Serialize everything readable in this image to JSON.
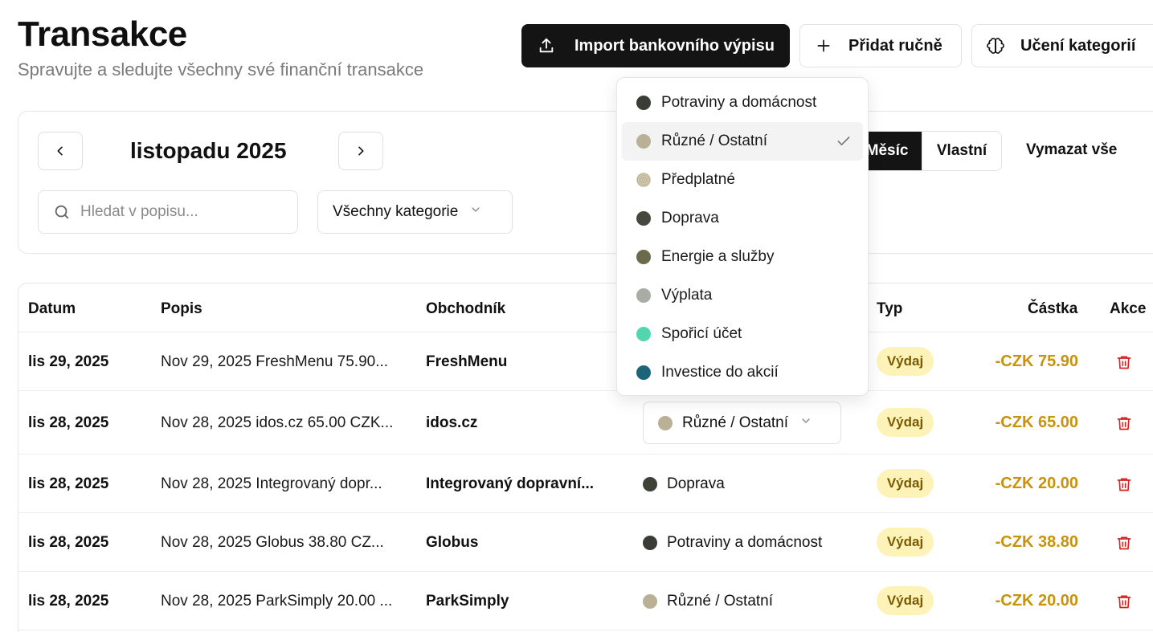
{
  "header": {
    "title": "Transakce",
    "subtitle": "Spravujte a sledujte všechny své finanční transakce",
    "import_label": "Import bankovního výpisu",
    "add_label": "Přidat ručně",
    "learn_label": "Učení kategorií"
  },
  "filters": {
    "month_label": "listopadu 2025",
    "search_placeholder": "Hledat v popisu...",
    "category_select": "Všechny kategorie",
    "segment_month": "Měsíc",
    "segment_custom": "Vlastní",
    "clear_all": "Vymazat vše"
  },
  "table": {
    "headers": {
      "date": "Datum",
      "description": "Popis",
      "merchant": "Obchodník",
      "type": "Typ",
      "amount": "Částka",
      "actions": "Akce"
    },
    "rows": [
      {
        "date": "lis 29, 2025",
        "description": "Nov 29, 2025 FreshMenu 75.90...",
        "merchant": "FreshMenu",
        "category": "",
        "category_color": "",
        "type": "Výdaj",
        "amount": "-CZK 75.90"
      },
      {
        "date": "lis 28, 2025",
        "description": "Nov 28, 2025 idos.cz 65.00 CZK...",
        "merchant": "idos.cz",
        "category": "Různé / Ostatní",
        "category_color": "#b9b096",
        "type": "Výdaj",
        "amount": "-CZK 65.00"
      },
      {
        "date": "lis 28, 2025",
        "description": "Nov 28, 2025 Integrovaný dopr...",
        "merchant": "Integrovaný dopravní...",
        "category": "Doprava",
        "category_color": "#3f4238",
        "type": "Výdaj",
        "amount": "-CZK 20.00"
      },
      {
        "date": "lis 28, 2025",
        "description": "Nov 28, 2025 Globus 38.80 CZ...",
        "merchant": "Globus",
        "category": "Potraviny a domácnost",
        "category_color": "#393d35",
        "type": "Výdaj",
        "amount": "-CZK 38.80"
      },
      {
        "date": "lis 28, 2025",
        "description": "Nov 28, 2025 ParkSimply 20.00 ...",
        "merchant": "ParkSimply",
        "category": "Různé / Ostatní",
        "category_color": "#b9b096",
        "type": "Výdaj",
        "amount": "-CZK 20.00"
      }
    ]
  },
  "category_menu": {
    "items": [
      {
        "label": "Potraviny a domácnost",
        "color": "#393d35",
        "selected": false
      },
      {
        "label": "Různé / Ostatní",
        "color": "#b9b096",
        "selected": true
      },
      {
        "label": "Předplatné",
        "color": "#c8c0a6",
        "selected": false
      },
      {
        "label": "Doprava",
        "color": "#46483e",
        "selected": false
      },
      {
        "label": "Energie a služby",
        "color": "#6b6b4c",
        "selected": false
      },
      {
        "label": "Výplata",
        "color": "#a9aca5",
        "selected": false
      },
      {
        "label": "Spořicí účet",
        "color": "#52d6b0",
        "selected": false
      },
      {
        "label": "Investice do akcií",
        "color": "#1f6378",
        "selected": false
      }
    ]
  },
  "colors": {
    "accent_dark": "#141414",
    "expense_amount": "#c9920a",
    "expense_badge_bg": "#fdf3b8",
    "delete_red": "#d42323"
  }
}
